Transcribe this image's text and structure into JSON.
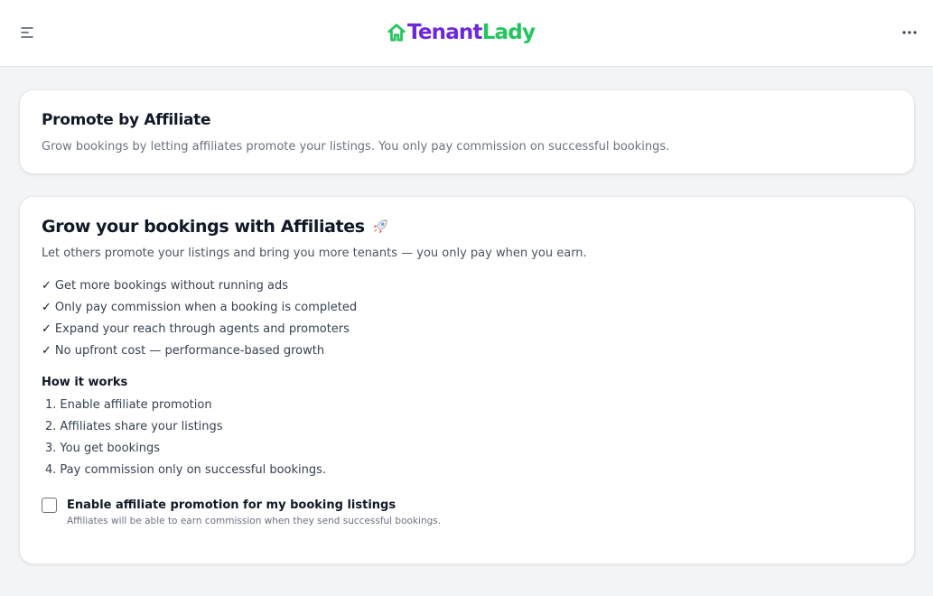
{
  "header": {
    "logo_word1": "Tenant",
    "logo_word2": "Lady",
    "menu_icon": "hamburger-icon",
    "more_icon": "more-horizontal-icon",
    "brand_colors": {
      "primary": "#6d28d9",
      "accent": "#22c55e"
    }
  },
  "promote_card": {
    "title": "Promote by Affiliate",
    "description": "Grow bookings by letting affiliates promote your listings. You only pay commission on successful bookings."
  },
  "grow_card": {
    "title": "Grow your bookings with Affiliates",
    "title_icon": "rocket-icon",
    "subtitle": "Let others promote your listings and bring you more tenants — you only pay when you earn.",
    "benefits": [
      {
        "check": "✓",
        "text": "Get more bookings without running ads"
      },
      {
        "check": "✓",
        "text": "Only pay commission when a booking is completed"
      },
      {
        "check": "✓",
        "text": "Expand your reach through agents and promoters"
      },
      {
        "check": "✓",
        "text": "No upfront cost — performance-based growth"
      }
    ],
    "how_title": "How it works",
    "steps": [
      {
        "num": "1.",
        "text": "Enable affiliate promotion"
      },
      {
        "num": "2.",
        "text": "Affiliates share your listings"
      },
      {
        "num": "3.",
        "text": "You get bookings"
      },
      {
        "num": "4.",
        "text": "Pay commission only on successful bookings."
      }
    ],
    "option": {
      "label": "Enable affiliate promotion for my booking listings",
      "help": "Affiliates will be able to earn commission when they send successful bookings.",
      "checked": false
    }
  }
}
